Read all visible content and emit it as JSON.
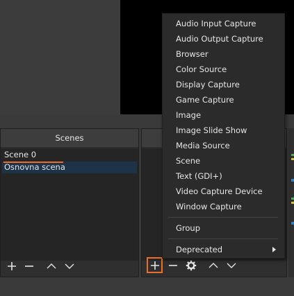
{
  "scenes": {
    "title": "Scenes",
    "items": [
      {
        "label": "Scene 0",
        "selected": false
      },
      {
        "label": "Osnovna scena",
        "selected": true
      }
    ]
  },
  "sources": {
    "title": ""
  },
  "toolbar": {
    "scenes_icons": [
      "plus-icon",
      "minus-icon",
      "chevron-up-icon",
      "chevron-down-icon"
    ],
    "sources_icons": [
      "plus-icon",
      "minus-icon",
      "gear-icon",
      "chevron-up-icon",
      "chevron-down-icon"
    ]
  },
  "context_menu": {
    "items": [
      "Audio Input Capture",
      "Audio Output Capture",
      "Browser",
      "Color Source",
      "Display Capture",
      "Game Capture",
      "Image",
      "Image Slide Show",
      "Media Source",
      "Scene",
      "Text (GDI+)",
      "Video Capture Device",
      "Window Capture"
    ],
    "group": "Group",
    "deprecated": "Deprecated"
  },
  "colors": {
    "accent": "#e8702a",
    "selection": "#1e3347",
    "meter_green": "#4caf50",
    "meter_yellow": "#d8c23a",
    "meter_blue": "#2f7fc1"
  }
}
